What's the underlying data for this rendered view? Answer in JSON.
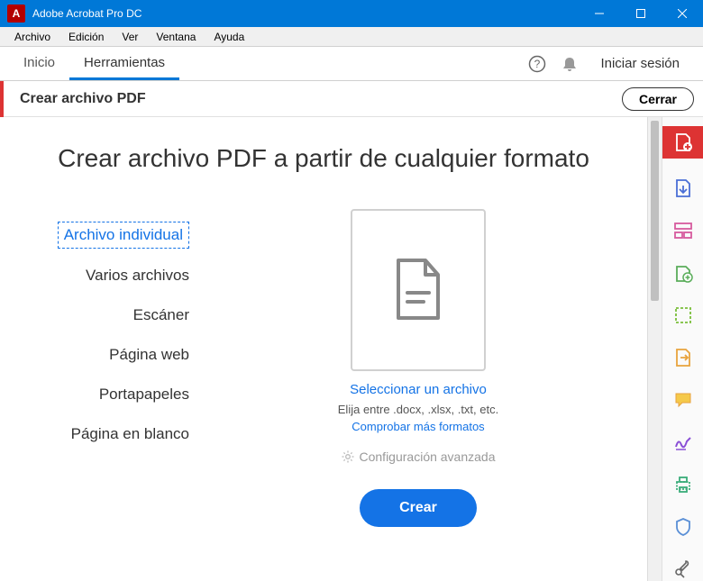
{
  "window": {
    "title": "Adobe Acrobat Pro DC",
    "icon_letter": "A"
  },
  "menubar": {
    "items": [
      "Archivo",
      "Edición",
      "Ver",
      "Ventana",
      "Ayuda"
    ]
  },
  "tabs": {
    "home": "Inicio",
    "tools": "Herramientas",
    "signin": "Iniciar sesión"
  },
  "toolbar": {
    "title": "Crear archivo PDF",
    "close": "Cerrar"
  },
  "main": {
    "heading": "Crear archivo PDF a partir de cualquier formato",
    "nav": {
      "single": "Archivo individual",
      "multiple": "Varios archivos",
      "scanner": "Escáner",
      "webpage": "Página web",
      "clipboard": "Portapapeles",
      "blank": "Página en blanco"
    },
    "select_file": "Seleccionar un archivo",
    "hint": "Elija entre .docx, .xlsx, .txt, etc.",
    "check_formats": "Comprobar más formatos",
    "advanced": "Configuración avanzada",
    "create": "Crear"
  },
  "rail_icons": [
    "create-pdf",
    "export-pdf",
    "organize",
    "combine",
    "edit",
    "comment",
    "sign",
    "print",
    "protect",
    "tools"
  ]
}
